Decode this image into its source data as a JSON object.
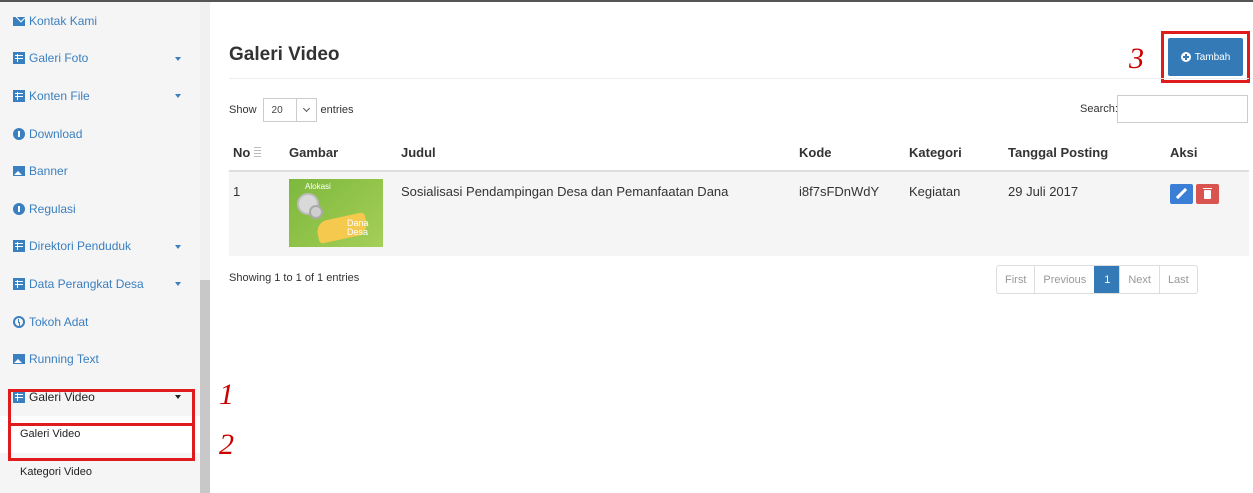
{
  "sidebar": {
    "items": [
      {
        "label": "Kontak Kami",
        "icon": "envelope-icon",
        "has_caret": false
      },
      {
        "label": "Galeri Foto",
        "icon": "list-icon",
        "has_caret": true
      },
      {
        "label": "Konten File",
        "icon": "list-icon",
        "has_caret": true
      },
      {
        "label": "Download",
        "icon": "info-circle-icon",
        "has_caret": false
      },
      {
        "label": "Banner",
        "icon": "image-icon",
        "has_caret": false
      },
      {
        "label": "Regulasi",
        "icon": "info-circle-icon",
        "has_caret": false
      },
      {
        "label": "Direktori Penduduk",
        "icon": "list-icon",
        "has_caret": true
      },
      {
        "label": "Data Perangkat Desa",
        "icon": "list-icon",
        "has_caret": true
      },
      {
        "label": "Tokoh Adat",
        "icon": "clock-icon",
        "has_caret": false
      },
      {
        "label": "Running Text",
        "icon": "image-icon",
        "has_caret": false
      },
      {
        "label": "Galeri Video",
        "icon": "list-icon",
        "has_caret": true
      }
    ],
    "sub_items": [
      {
        "label": "Galeri Video"
      },
      {
        "label": "Kategori Video"
      }
    ]
  },
  "annotations": [
    "1",
    "2",
    "3"
  ],
  "main": {
    "title": "Galeri Video",
    "add_button": "Tambah",
    "show_label": "Show",
    "entries_value": "20",
    "entries_label": "entries",
    "search_label": "Search:",
    "search_value": "",
    "columns": [
      "No",
      "Gambar",
      "Judul",
      "Kode",
      "Kategori",
      "Tanggal Posting",
      "Aksi"
    ],
    "rows": [
      {
        "no": "1",
        "thumbnail_text_top": "Alokasi",
        "thumbnail_text_bottom": "Dana Desa",
        "judul": "Sosialisasi Pendampingan Desa dan Pemanfaatan Dana",
        "kode": "i8f7sFDnWdY",
        "kategori": "Kegiatan",
        "tanggal": "29 Juli 2017"
      }
    ],
    "info": "Showing 1 to 1 of 1 entries",
    "pagination": [
      "First",
      "Previous",
      "1",
      "Next",
      "Last"
    ]
  },
  "colors": {
    "primary": "#337ab7",
    "danger": "#d9534f",
    "annotation": "#e01b1b",
    "sidebar_link": "#3a7fbf"
  }
}
